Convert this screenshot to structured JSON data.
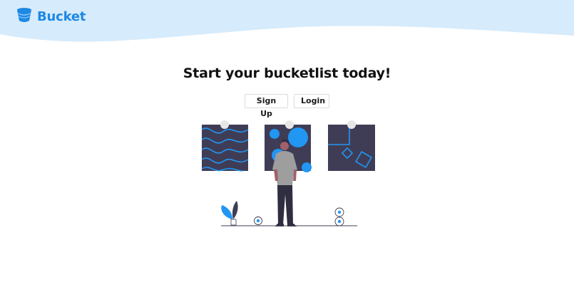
{
  "header": {
    "logo_icon": "bucket-icon",
    "brand_name": "Bucket",
    "wave_color": "#d6ebfb",
    "brand_color": "#1e88e5"
  },
  "hero": {
    "title": "Start your bucketlist today!",
    "buttons": {
      "signup_label": "Sign Up",
      "login_label": "Login"
    }
  },
  "illustration": {
    "name": "person-viewing-art-illustration",
    "accent_color": "#2196f3",
    "dark_color": "#3f3d56"
  }
}
